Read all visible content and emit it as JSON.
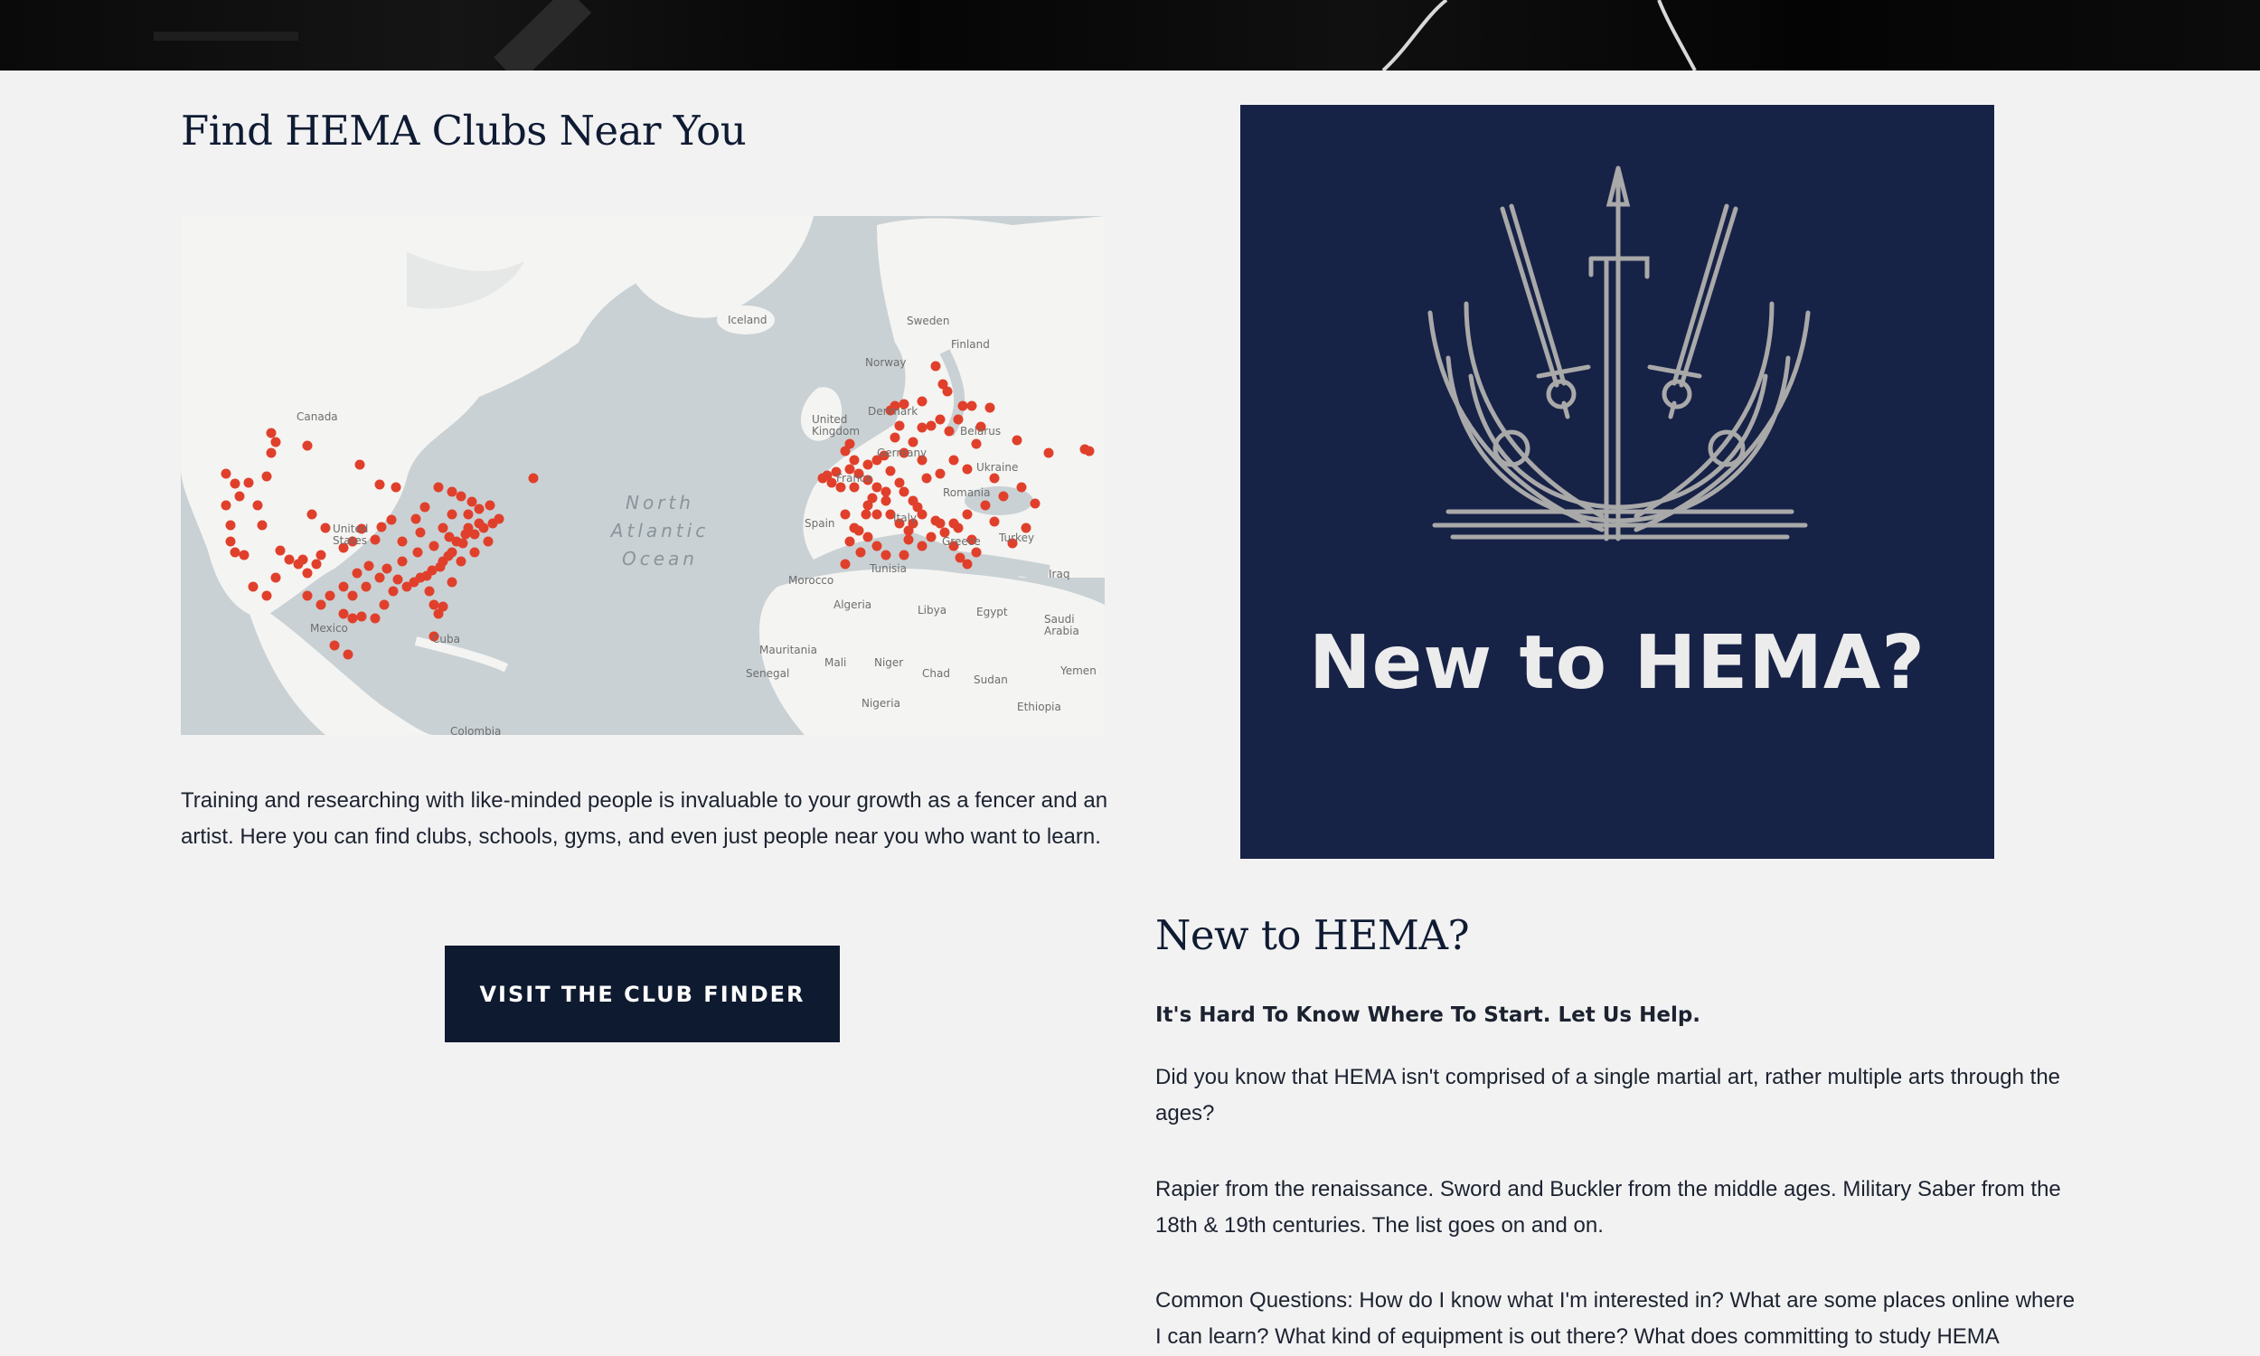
{
  "clubs_section": {
    "title": "Find HEMA Clubs Near You",
    "description": "Training and researching with like-minded people is invaluable to your growth as a fencer and an artist. Here you can find clubs, schools, gyms, and even just people near you who want to learn.",
    "button_label": "VISIT THE CLUB FINDER"
  },
  "map": {
    "ocean_label": "North Atlantic Ocean",
    "marker_color": "#e0402b",
    "water_color": "#c9d1d4",
    "land_color": "#f4f4f2",
    "places": [
      "Canada",
      "United States",
      "Mexico",
      "Cuba",
      "Colombia",
      "Iceland",
      "Sweden",
      "Finland",
      "Norway",
      "Denmark",
      "United Kingdom",
      "Germany",
      "Belarus",
      "France",
      "Ukraine",
      "Romania",
      "Spain",
      "Italy",
      "Greece",
      "Turkey",
      "Tunisia",
      "Morocco",
      "Iraq",
      "Algeria",
      "Libya",
      "Egypt",
      "Saudi Arabia",
      "Mauritania",
      "Mali",
      "Niger",
      "Chad",
      "Sudan",
      "Senegal",
      "Yemen",
      "Nigeria",
      "Ethiopia"
    ]
  },
  "promo_image": {
    "text": "New to HEMA?",
    "background": "#172247"
  },
  "new_section": {
    "title": "New to HEMA?",
    "subtitle": "It's Hard To Know Where To Start. Let Us Help.",
    "paragraphs": [
      "Did you know that HEMA isn't comprised of a single martial art, rather multiple arts through the ages?",
      "Rapier from the renaissance. Sword and Buckler from the middle ages. Military Saber from the 18th & 19th centuries. The list goes on and on.",
      "Common Questions: How do I know what I'm interested in? What are some places online where I can learn? What kind of equipment is out there? What does committing to study HEMA"
    ]
  }
}
